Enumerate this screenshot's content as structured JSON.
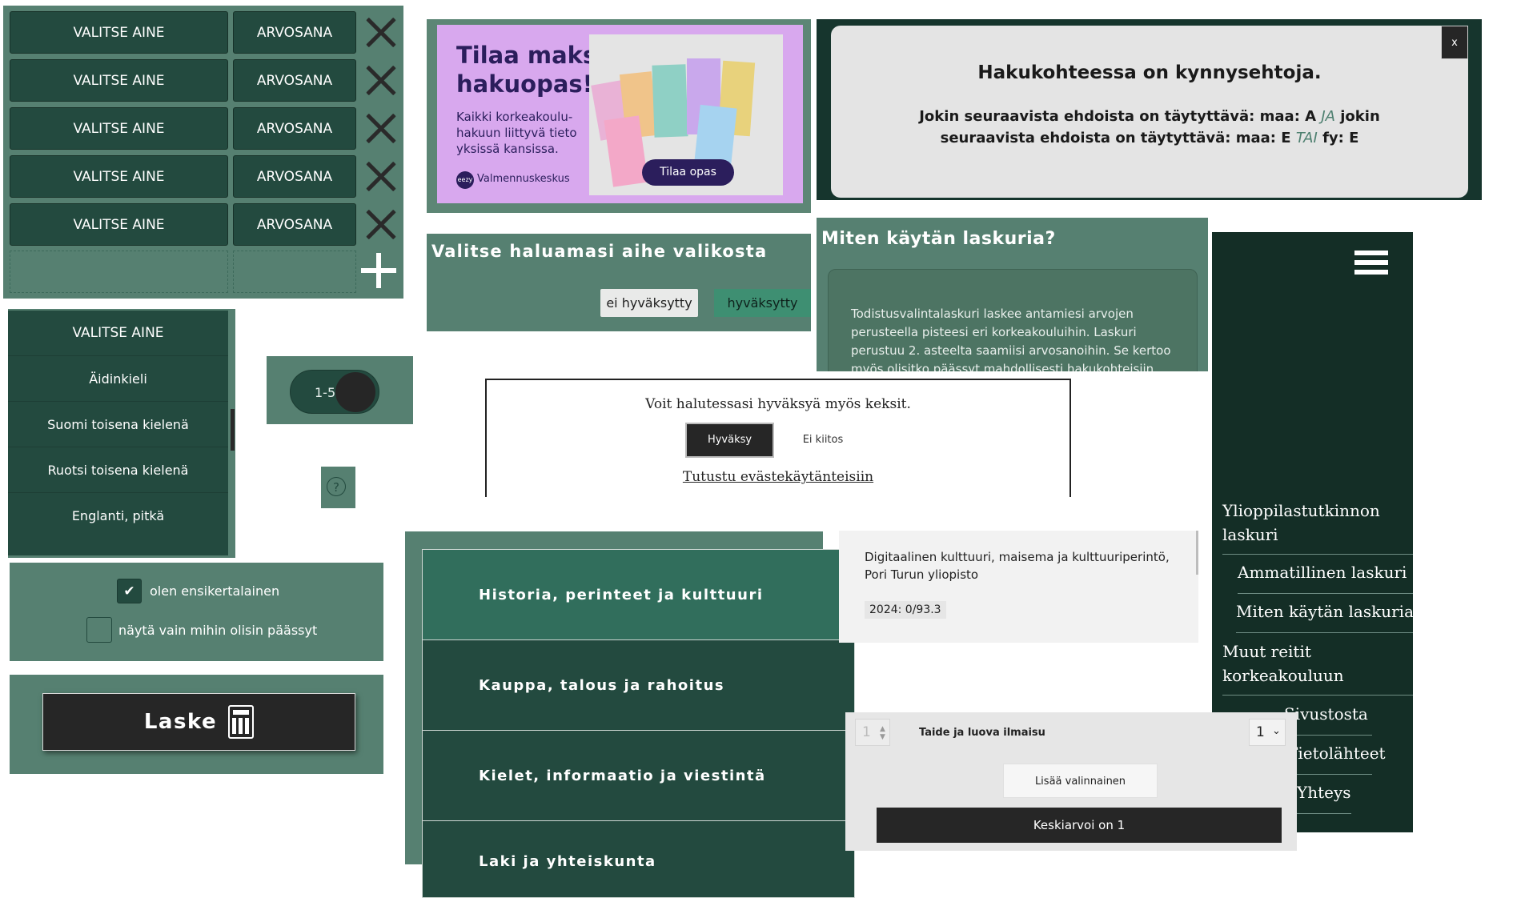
{
  "grades": {
    "rows": [
      {
        "subject": "VALITSE AINE",
        "grade": "ARVOSANA"
      },
      {
        "subject": "VALITSE AINE",
        "grade": "ARVOSANA"
      },
      {
        "subject": "VALITSE AINE",
        "grade": "ARVOSANA"
      },
      {
        "subject": "VALITSE AINE",
        "grade": "ARVOSANA"
      },
      {
        "subject": "VALITSE AINE",
        "grade": "ARVOSANA"
      }
    ],
    "remove_icon": "close-icon",
    "add_icon": "plus-icon"
  },
  "dropdown": {
    "items": [
      "VALITSE AINE",
      "Äidinkieli",
      "Suomi toisena kielenä",
      "Ruotsi toisena kielenä",
      "Englanti, pitkä"
    ]
  },
  "toggle": {
    "label": "1-5"
  },
  "help": {
    "label": "?"
  },
  "checkboxes": {
    "first_timer": {
      "label": "olen ensikertalainen",
      "checked": true
    },
    "only_admitted": {
      "label": "näytä vain mihin olisin päässyt",
      "checked": false
    }
  },
  "calculate": {
    "label": "Laske",
    "icon": "calculator-icon"
  },
  "ad": {
    "title_line1": "Tilaa maksuton",
    "title_line2": "hakuopas!",
    "body": [
      "Kaikki korkeakoulu-",
      "hakuun liittyvä tieto",
      "yksissä kansissa."
    ],
    "brand": "Valmennuskeskus",
    "brand_logo": "eezy",
    "cta": "Tilaa opas"
  },
  "filter": {
    "title": "Valitse haluamasi aihe valikosta",
    "not_accepted": "ei hyväksytty",
    "accepted": "hyväksytty"
  },
  "threshold_modal": {
    "title": "Hakukohteessa on kynnysehtoja.",
    "line1_pre": "Jokin seuraavista ehdoista on täytyttävä: maa: A ",
    "line1_kw": "JA",
    "line1_post": " jokin",
    "line2_pre": "seuraavista ehdoista on täytyttävä: maa: E ",
    "line2_kw": "TAI",
    "line2_post": " fy: E",
    "close": "x"
  },
  "howto": {
    "title": "Miten käytän laskuria?",
    "body": "Todistusvalintalaskuri laskee antamiesi arvojen perusteella pisteesi eri korkeakouluihin. Laskuri perustuu 2. asteelta saamiisi arvosanoihin. Se kertoo myös olisitko päässyt mahdollisesti hakukohteisiin"
  },
  "cookie": {
    "text": "Voit halutessasi hyväksyä myös keksit.",
    "accept": "Hyväksy",
    "decline": "Ei kiitos",
    "link": "Tutustu evästekäytänteisiin"
  },
  "subjects": [
    "Historia, perinteet ja kulttuuri",
    "Kauppa, talous ja rahoitus",
    "Kielet, informaatio ja viestintä",
    "Laki ja yhteiskunta"
  ],
  "result_card": {
    "line1": "Digitaalinen kulttuuri, maisema ja kulttuuriperintö,",
    "line2": "Pori Turun yliopisto",
    "badge": "2024: 0/93.3"
  },
  "nav": {
    "menu_icon": "hamburger-icon",
    "items": [
      {
        "line1": "Ylioppilastutkinnon",
        "line2": "laskuri"
      },
      {
        "line1": "Ammatillinen laskuri"
      },
      {
        "line1": "Miten käytän laskuria"
      },
      {
        "line1": "Muut reitit",
        "line2": "korkeakouluun"
      },
      {
        "line1": "Sivustosta"
      },
      {
        "line1": "Tietolähteet"
      },
      {
        "line1": "Yhteys"
      }
    ]
  },
  "elective": {
    "stepper_value": "1",
    "subject": "Taide ja luova ilmaisu",
    "grade_value": "1",
    "add_label": "Lisää valinnainen",
    "average_label": "Keskiarvoi on 1"
  }
}
